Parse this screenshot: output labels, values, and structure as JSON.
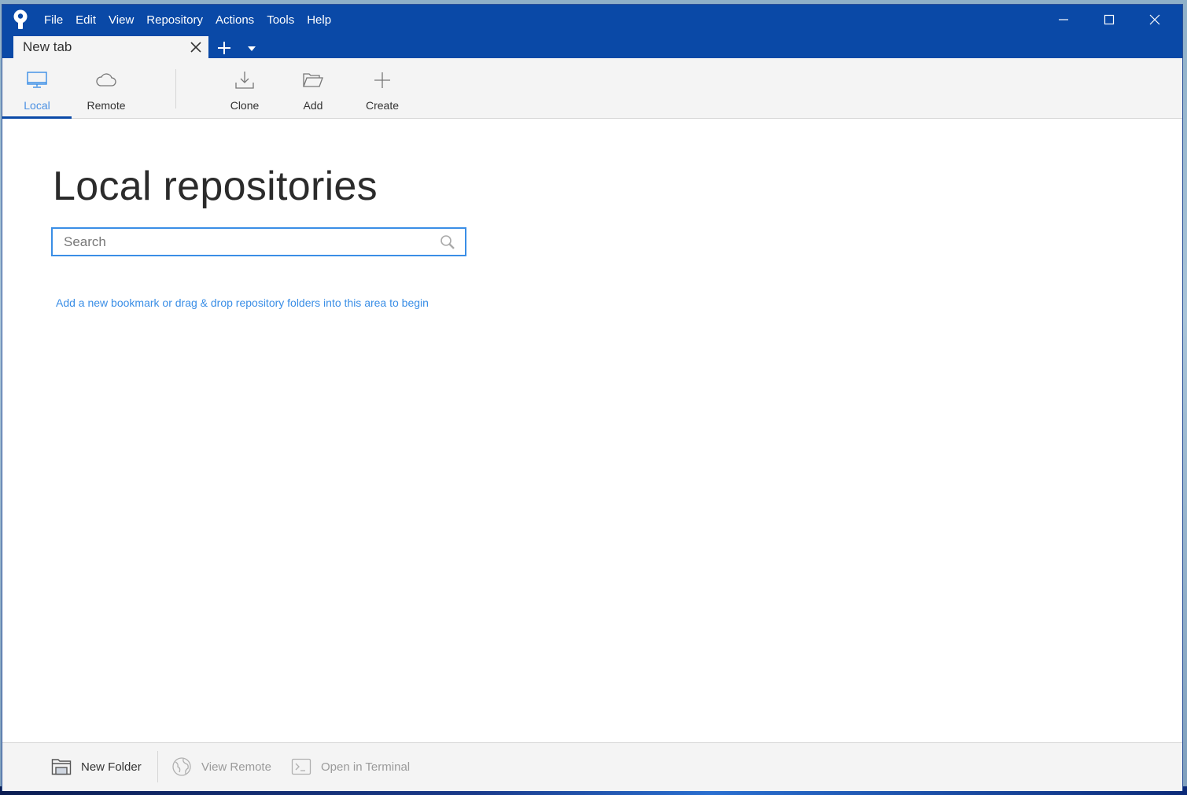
{
  "window": {
    "menu": [
      "File",
      "Edit",
      "View",
      "Repository",
      "Actions",
      "Tools",
      "Help"
    ],
    "controls": {
      "minimize": "minimize-icon",
      "maximize": "maximize-icon",
      "close": "close-icon"
    }
  },
  "tabs": {
    "items": [
      {
        "label": "New tab",
        "active": true
      }
    ],
    "add_icon": "plus-icon",
    "dropdown_icon": "caret-down-icon"
  },
  "toolbar": {
    "view_toggle": [
      {
        "label": "Local",
        "icon": "monitor-icon",
        "active": true
      },
      {
        "label": "Remote",
        "icon": "cloud-icon",
        "active": false
      }
    ],
    "actions": [
      {
        "label": "Clone",
        "icon": "download-icon"
      },
      {
        "label": "Add",
        "icon": "folder-open-icon"
      },
      {
        "label": "Create",
        "icon": "plus-icon"
      }
    ]
  },
  "main": {
    "title": "Local repositories",
    "search": {
      "placeholder": "Search",
      "value": ""
    },
    "hint": "Add a new bookmark or drag & drop repository folders into this area to begin"
  },
  "statusbar": {
    "buttons": [
      {
        "label": "New Folder",
        "icon": "new-folder-icon",
        "enabled": true
      },
      {
        "label": "View Remote",
        "icon": "globe-icon",
        "enabled": false
      },
      {
        "label": "Open in Terminal",
        "icon": "terminal-icon",
        "enabled": false
      }
    ]
  },
  "colors": {
    "titlebar": "#0a49a7",
    "accent": "#3a8ee6",
    "active_underline": "#0a49a7",
    "toolbar_bg": "#f4f4f4"
  }
}
